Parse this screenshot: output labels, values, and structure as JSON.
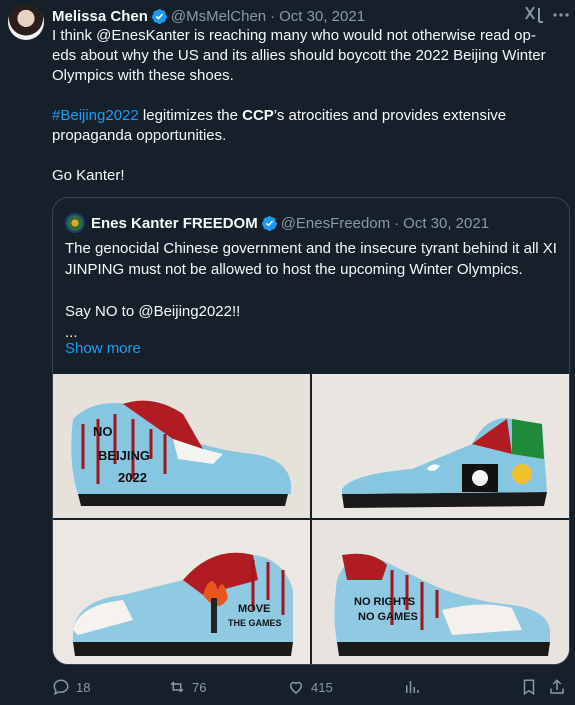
{
  "tweet": {
    "author_name": "Melissa Chen",
    "handle": "@MsMelChen",
    "separator": "·",
    "date": "Oct 30, 2021",
    "text_line1": "I think @EnesKanter is reaching many who would not otherwise read op-eds about why the US and its allies should boycott the 2022 Beijing Winter Olympics with these shoes.",
    "hashtag": "#Beijing2022",
    "text_mid": " legitimizes the ",
    "ccp": "CCP",
    "text_end": "’s atrocities and provides extensive propaganda opportunities.",
    "closing": "Go Kanter!"
  },
  "quote": {
    "author_name": "Enes Kanter FREEDOM",
    "handle": "@EnesFreedom",
    "separator": "·",
    "date": "Oct 30, 2021",
    "line1": "The genocidal Chinese government and the insecure tyrant behind it all XI JINPING must not be allowed to host the upcoming Winter Olympics.",
    "line2": "Say NO to @Beijing2022!!",
    "line3": "...",
    "show_more": "Show more"
  },
  "images": {
    "img1_text": [
      "NO",
      "BEIJING",
      "2022"
    ],
    "img3_text": [
      "MOVE",
      "THE GAMES"
    ],
    "img4_text": [
      "NO RIGHTS",
      "NO GAMES"
    ]
  },
  "actions": {
    "replies": "18",
    "retweets": "76",
    "likes": "415"
  },
  "icons": [
    "verified-badge-icon",
    "grok-icon",
    "more-icon",
    "reply-icon",
    "retweet-icon",
    "like-icon",
    "views-icon",
    "bookmark-icon",
    "share-icon"
  ],
  "colors": {
    "background": "#15202b",
    "link": "#1d9bf0",
    "muted": "#8b98a5",
    "verified": "#1d9bf0"
  }
}
